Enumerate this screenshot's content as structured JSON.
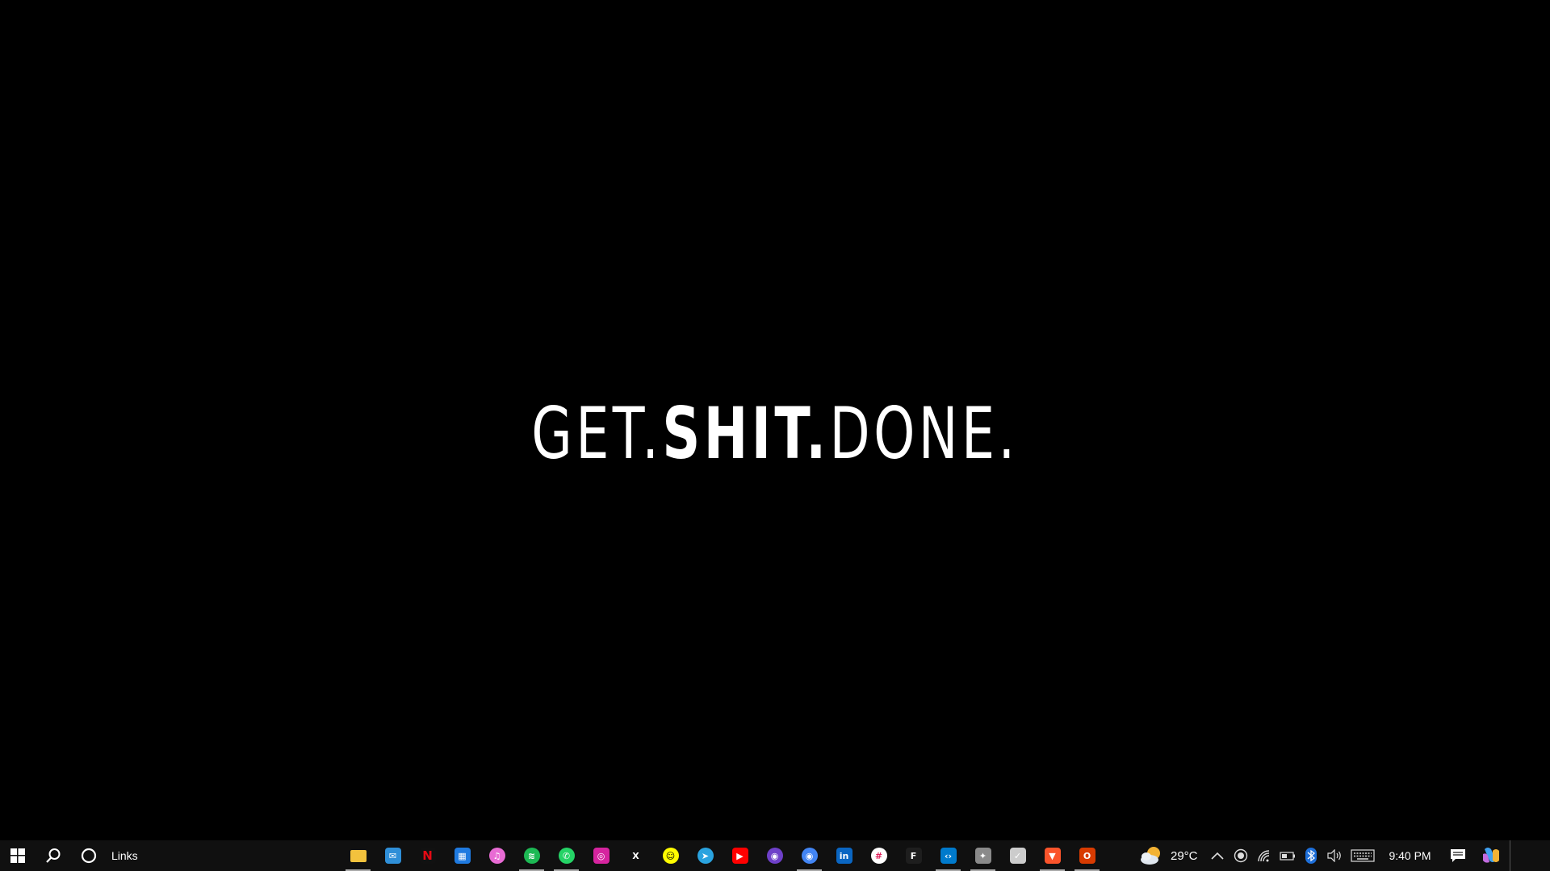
{
  "wallpaper": {
    "text_part1": "GET.",
    "text_part2": "SHIT.",
    "text_part3": "DONE."
  },
  "taskbar": {
    "toolbar_label": "Links",
    "pinned_apps": [
      {
        "name": "File Explorer",
        "icon": "folder-icon",
        "color": "#f3c23d",
        "running": true
      },
      {
        "name": "Mail",
        "icon": "mail-icon",
        "color": "#2f8fd8",
        "running": false
      },
      {
        "name": "Netflix",
        "icon": "netflix-icon",
        "color": "#e50914",
        "running": false
      },
      {
        "name": "Calendar",
        "icon": "calendar-icon",
        "color": "#1f7ae0",
        "running": false
      },
      {
        "name": "iTunes",
        "icon": "itunes-icon",
        "color": "#e86bd4",
        "running": false
      },
      {
        "name": "Spotify",
        "icon": "spotify-icon",
        "color": "#1db954",
        "running": true
      },
      {
        "name": "WhatsApp",
        "icon": "whatsapp-icon",
        "color": "#25d366",
        "running": true
      },
      {
        "name": "Instagram",
        "icon": "instagram-icon",
        "color": "#d6249f",
        "running": false
      },
      {
        "name": "X",
        "icon": "x-icon",
        "color": "#000000",
        "running": false
      },
      {
        "name": "Snapchat",
        "icon": "snapchat-icon",
        "color": "#fffc00",
        "running": false
      },
      {
        "name": "Telegram",
        "icon": "telegram-icon",
        "color": "#2aa3df",
        "running": false
      },
      {
        "name": "YouTube",
        "icon": "youtube-icon",
        "color": "#ff0000",
        "running": false
      },
      {
        "name": "GitHub",
        "icon": "github-icon",
        "color": "#6e40c9",
        "running": false
      },
      {
        "name": "Chrome",
        "icon": "chrome-icon",
        "color": "#4285f4",
        "running": true
      },
      {
        "name": "LinkedIn",
        "icon": "linkedin-icon",
        "color": "#0a66c2",
        "running": false
      },
      {
        "name": "Slack",
        "icon": "slack-icon",
        "color": "#e8e8e8",
        "running": false
      },
      {
        "name": "Figma",
        "icon": "figma-icon",
        "color": "#1e1e1e",
        "running": false
      },
      {
        "name": "Visual Studio Code",
        "icon": "vscode-icon",
        "color": "#007acc",
        "running": true
      },
      {
        "name": "Game",
        "icon": "game-icon",
        "color": "#8a8a8a",
        "running": true
      },
      {
        "name": "Check App",
        "icon": "checkbox-icon",
        "color": "#cccccc",
        "running": false
      },
      {
        "name": "Brave",
        "icon": "brave-icon",
        "color": "#fb542b",
        "running": true
      },
      {
        "name": "Office",
        "icon": "office-icon",
        "color": "#d83b01",
        "running": true
      }
    ]
  },
  "tray": {
    "weather_temp": "29°C",
    "clock_time": "9:40 PM"
  }
}
